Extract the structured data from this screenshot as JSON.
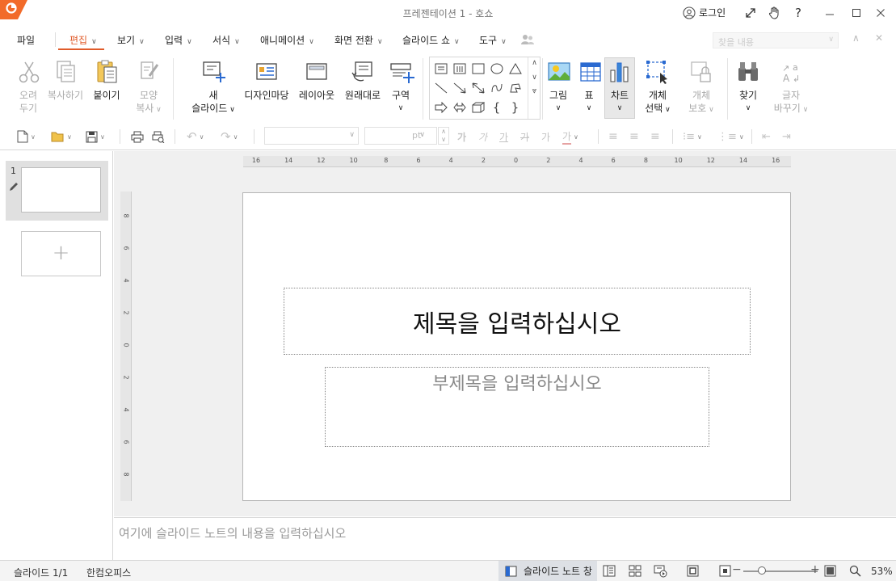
{
  "window": {
    "title": "프레젠테이션 1 - 호쇼",
    "login_label": "로그인"
  },
  "menu": {
    "file": "파일",
    "items": [
      {
        "label": "편집",
        "active": true
      },
      {
        "label": "보기"
      },
      {
        "label": "입력"
      },
      {
        "label": "서식"
      },
      {
        "label": "애니메이션"
      },
      {
        "label": "화면 전환"
      },
      {
        "label": "슬라이드 쇼"
      },
      {
        "label": "도구"
      }
    ],
    "search_placeholder": "찾을 내용"
  },
  "ribbon": {
    "cut": {
      "line1": "오려",
      "line2": "두기"
    },
    "copy": {
      "line1": "복사하기"
    },
    "paste": {
      "line1": "붙이기"
    },
    "format_copy": {
      "line1": "모양",
      "line2": "복사"
    },
    "new_slide": {
      "line1": "새",
      "line2": "슬라이드"
    },
    "design": {
      "line1": "디자인마당"
    },
    "layout": {
      "line1": "레이아웃"
    },
    "reset": {
      "line1": "원래대로"
    },
    "section": {
      "line1": "구역"
    },
    "picture": {
      "line1": "그림"
    },
    "table": {
      "line1": "표"
    },
    "chart": {
      "line1": "차트"
    },
    "object_select": {
      "line1": "개체",
      "line2": "선택"
    },
    "object_protect": {
      "line1": "개체",
      "line2": "보호"
    },
    "find": {
      "line1": "찾기"
    },
    "replace": {
      "line1": "글자",
      "line2": "바꾸기"
    }
  },
  "toolbar": {
    "font_size_unit": "pt",
    "char_glyphs": [
      "가",
      "가",
      "가",
      "가",
      "가",
      "가"
    ]
  },
  "slides_panel": {
    "slide_number": "1",
    "add_slide_glyph": "+"
  },
  "ruler": {
    "horizontal": [
      "16",
      "14",
      "12",
      "10",
      "8",
      "6",
      "4",
      "2",
      "0",
      "2",
      "4",
      "6",
      "8",
      "10",
      "12",
      "14",
      "16"
    ],
    "vertical": [
      "8",
      "6",
      "4",
      "2",
      "0",
      "2",
      "4",
      "6",
      "8"
    ]
  },
  "slide": {
    "title_placeholder": "제목을 입력하십시오",
    "subtitle_placeholder": "부제목을 입력하십시오"
  },
  "notes": {
    "placeholder": "여기에 슬라이드 노트의 내용을 입력하십시오"
  },
  "status": {
    "slide_counter": "슬라이드 1/1",
    "app_name": "한컴오피스",
    "note_view": "슬라이드 노트 창",
    "zoom": "53%"
  },
  "colors": {
    "accent": "#e05b2a",
    "chart_active_bg": "#e8e8e8"
  }
}
